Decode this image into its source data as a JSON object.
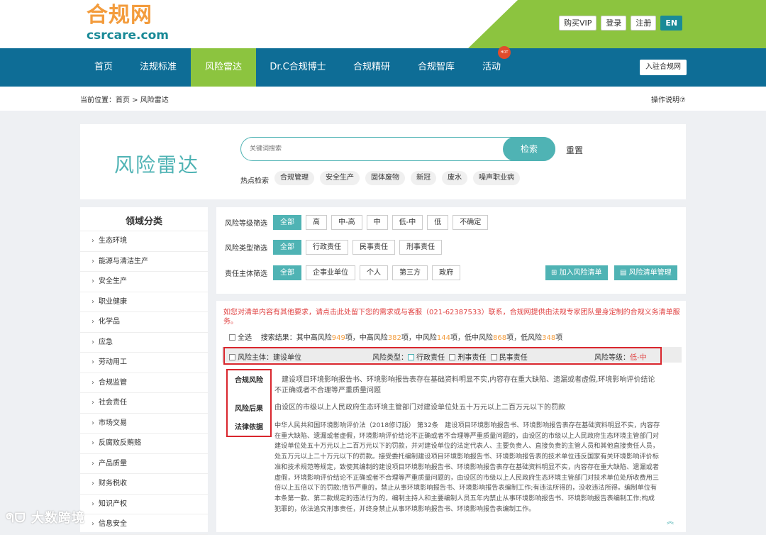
{
  "brand": {
    "cn": "合规网",
    "en": "csrcare.com"
  },
  "top_buttons": [
    "购买VIP",
    "登录",
    "注册",
    "EN"
  ],
  "nav": {
    "items": [
      "首页",
      "法规标准",
      "风险雷达",
      "Dr.C合规博士",
      "合规精研",
      "合规智库",
      "活动"
    ],
    "hot": "HOT",
    "join": "入驻合规网"
  },
  "breadcrumb": "当前位置：首页 > 风险雷达",
  "help": "操作说明⑦",
  "search": {
    "title": "风险雷达",
    "placeholder": "关键词搜索",
    "button": "检索",
    "reset": "重置",
    "hot_label": "热点检索",
    "hot_tags": [
      "合规管理",
      "安全生产",
      "固体废物",
      "新冠",
      "废水",
      "噪声职业病"
    ]
  },
  "sidebar": {
    "title": "领域分类",
    "items": [
      "生态环境",
      "能源与清洁生产",
      "安全生产",
      "职业健康",
      "化学品",
      "应急",
      "劳动用工",
      "合规监管",
      "社会责任",
      "市场交易",
      "反腐败反贿赂",
      "产品质量",
      "财务税收",
      "知识产权",
      "信息安全"
    ]
  },
  "filters": {
    "level": {
      "label": "风险等级筛选",
      "options": [
        "全部",
        "高",
        "中-高",
        "中",
        "低-中",
        "低",
        "不确定"
      ]
    },
    "type": {
      "label": "风险类型筛选",
      "options": [
        "全部",
        "行政责任",
        "民事责任",
        "刑事责任"
      ]
    },
    "subject": {
      "label": "责任主体筛选",
      "options": [
        "全部",
        "企事业单位",
        "个人",
        "第三方",
        "政府"
      ]
    },
    "add_button": "加入风险清单",
    "manage_button": "风险清单管理"
  },
  "results": {
    "notice": "如您对清单内容有其他要求，请点击此处留下您的需求或与客服（021-62387533）联系，合规网提供由法规专家团队量身定制的合规义务清单服务。",
    "select_all": "全选",
    "stats_prefix": "搜索结果：其中高风险",
    "high": "949",
    "stats_mid_high_label": "项，中高风险",
    "mid_high": "382",
    "stats_mid_label": "项，中风险",
    "mid": "144",
    "stats_low_mid_label": "项，低中风险",
    "low_mid": "868",
    "stats_low_label": "项，低风险",
    "low": "348",
    "stats_suffix": "项",
    "item": {
      "subject_label": "风险主体：",
      "subject": "建设单位",
      "type_label": "风险类型：",
      "types": [
        "行政责任",
        "刑事责任",
        "民事责任"
      ],
      "level_label": "风险等级：",
      "level": "低-中",
      "risk_label": "合规风险",
      "risk_text": "建设项目环境影响报告书、环境影响报告表存在基础资料明显不实,内容存在重大缺陷、遗漏或者虚假,环境影响评价结论不正确或者不合理等严重质量问题",
      "consequence_label": "风险后果",
      "consequence_text": "由设区的市级以上人民政府生态环境主管部门对建设单位处五十万元以上二百万元以下的罚款",
      "basis_label": "法律依据",
      "basis_text": "中华人民共和国环境影响评价法（2018修订版） 第32条　建设项目环境影响报告书、环境影响报告表存在基础资料明显不实，内容存在重大缺陷、遗漏或者虚假，环境影响评价结论不正确或者不合理等严重质量问题的，由设区的市级以上人民政府生态环境主管部门对建设单位处五十万元以上二百万元以下的罚款，并对建设单位的法定代表人、主要负责人、直接负责的主管人员和其他直接责任人员，处五万元以上二十万元以下的罚款。接受委托编制建设项目环境影响报告书、环境影响报告表的技术单位违反国家有关环境影响评价标准和技术规范等规定，致使其编制的建设项目环境影响报告书、环境影响报告表存在基础资料明显不实，内容存在重大缺陷、遗漏或者虚假，环境影响评价结论不正确或者不合理等严重质量问题的，由设区的市级以上人民政府生态环境主管部门对技术单位处所收费用三倍以上五倍以下的罚款;情节严重的，禁止从事环境影响报告书、环境影响报告表编制工作;有违法所得的，没收违法所得。编制单位有本条第一款、第二款规定的违法行为的，编制主持人和主要编制人员五年内禁止从事环境影响报告书、环境影响报告表编制工作;构成犯罪的，依法追究刑事责任，并终身禁止从事环境影响报告书、环境影响报告表编制工作。"
    }
  },
  "watermark": "大数跨境",
  "colors": {
    "nav": "#0e6d96",
    "accent": "#8cc43f",
    "teal": "#4fb3b4",
    "orange": "#f39c3d",
    "red": "#d9262d"
  }
}
